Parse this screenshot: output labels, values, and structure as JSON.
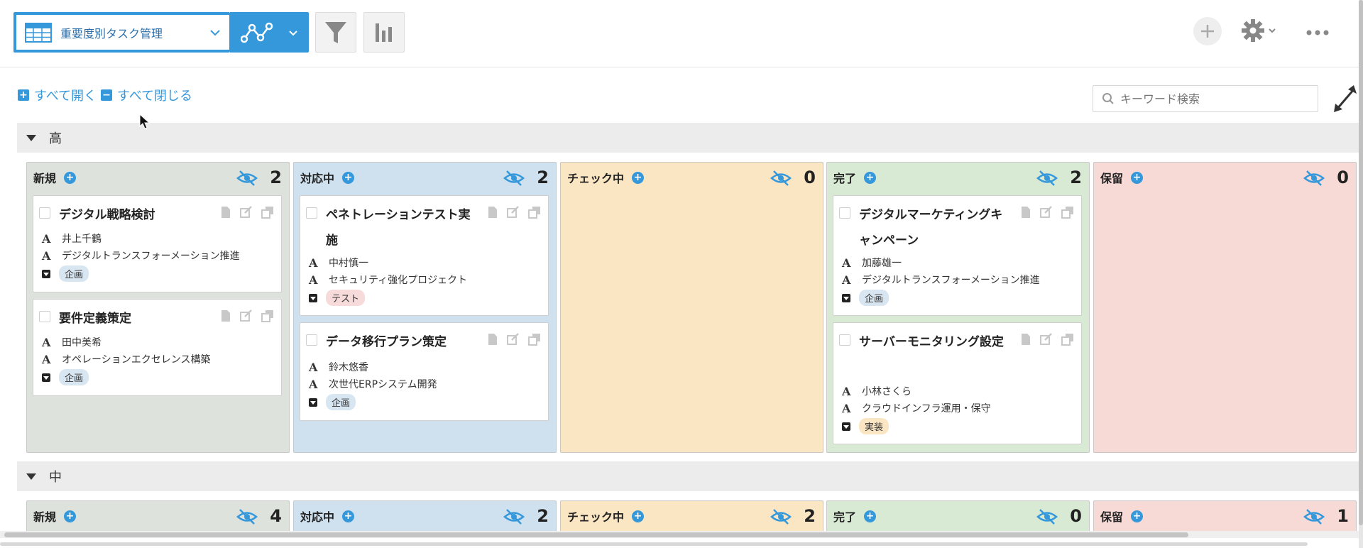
{
  "toolbar": {
    "view_title": "重要度別タスク管理",
    "icons": [
      "table-icon",
      "chevron-down-icon",
      "graph-icon",
      "filter-icon",
      "bar-chart-icon",
      "plus-icon",
      "gear-icon",
      "more-icon"
    ]
  },
  "controls": {
    "expand_all": "すべて開く",
    "collapse_all": "すべて閉じる",
    "search_placeholder": "キーワード検索"
  },
  "groups": [
    {
      "label": "高",
      "columns": [
        {
          "name": "新規",
          "count": "2",
          "cards": [
            {
              "title": "デジタル戦略検討",
              "assignee": "井上千鶴",
              "project": "デジタルトランスフォーメーション推進",
              "tag": "企画"
            },
            {
              "title": "要件定義策定",
              "assignee": "田中美希",
              "project": "オペレーションエクセレンス構築",
              "tag": "企画"
            }
          ]
        },
        {
          "name": "対応中",
          "count": "2",
          "cards": [
            {
              "title": "ペネトレーションテスト実施",
              "assignee": "中村慎一",
              "project": "セキュリティ強化プロジェクト",
              "tag": "テスト"
            },
            {
              "title": "データ移行プラン策定",
              "assignee": "鈴木悠香",
              "project": "次世代ERPシステム開発",
              "tag": "企画"
            }
          ]
        },
        {
          "name": "チェック中",
          "count": "0",
          "cards": []
        },
        {
          "name": "完了",
          "count": "2",
          "cards": [
            {
              "title": "デジタルマーケティングキャンペーン",
              "assignee": "加藤雄一",
              "project": "デジタルトランスフォーメーション推進",
              "tag": "企画"
            },
            {
              "title": "サーバーモニタリング設定",
              "assignee": "小林さくら",
              "project": "クラウドインフラ運用・保守",
              "tag": "実装"
            }
          ]
        },
        {
          "name": "保留",
          "count": "0",
          "cards": []
        }
      ]
    },
    {
      "label": "中",
      "columns": [
        {
          "name": "新規",
          "count": "4"
        },
        {
          "name": "対応中",
          "count": "2"
        },
        {
          "name": "チェック中",
          "count": "2"
        },
        {
          "name": "完了",
          "count": "0"
        },
        {
          "name": "保留",
          "count": "1"
        }
      ]
    }
  ],
  "colors": {
    "accent": "#3498db",
    "new": "#dde2dd",
    "doing": "#cfe1ef",
    "check": "#fbe6c4",
    "done": "#d8e9d4",
    "hold": "#f7d9d6"
  }
}
